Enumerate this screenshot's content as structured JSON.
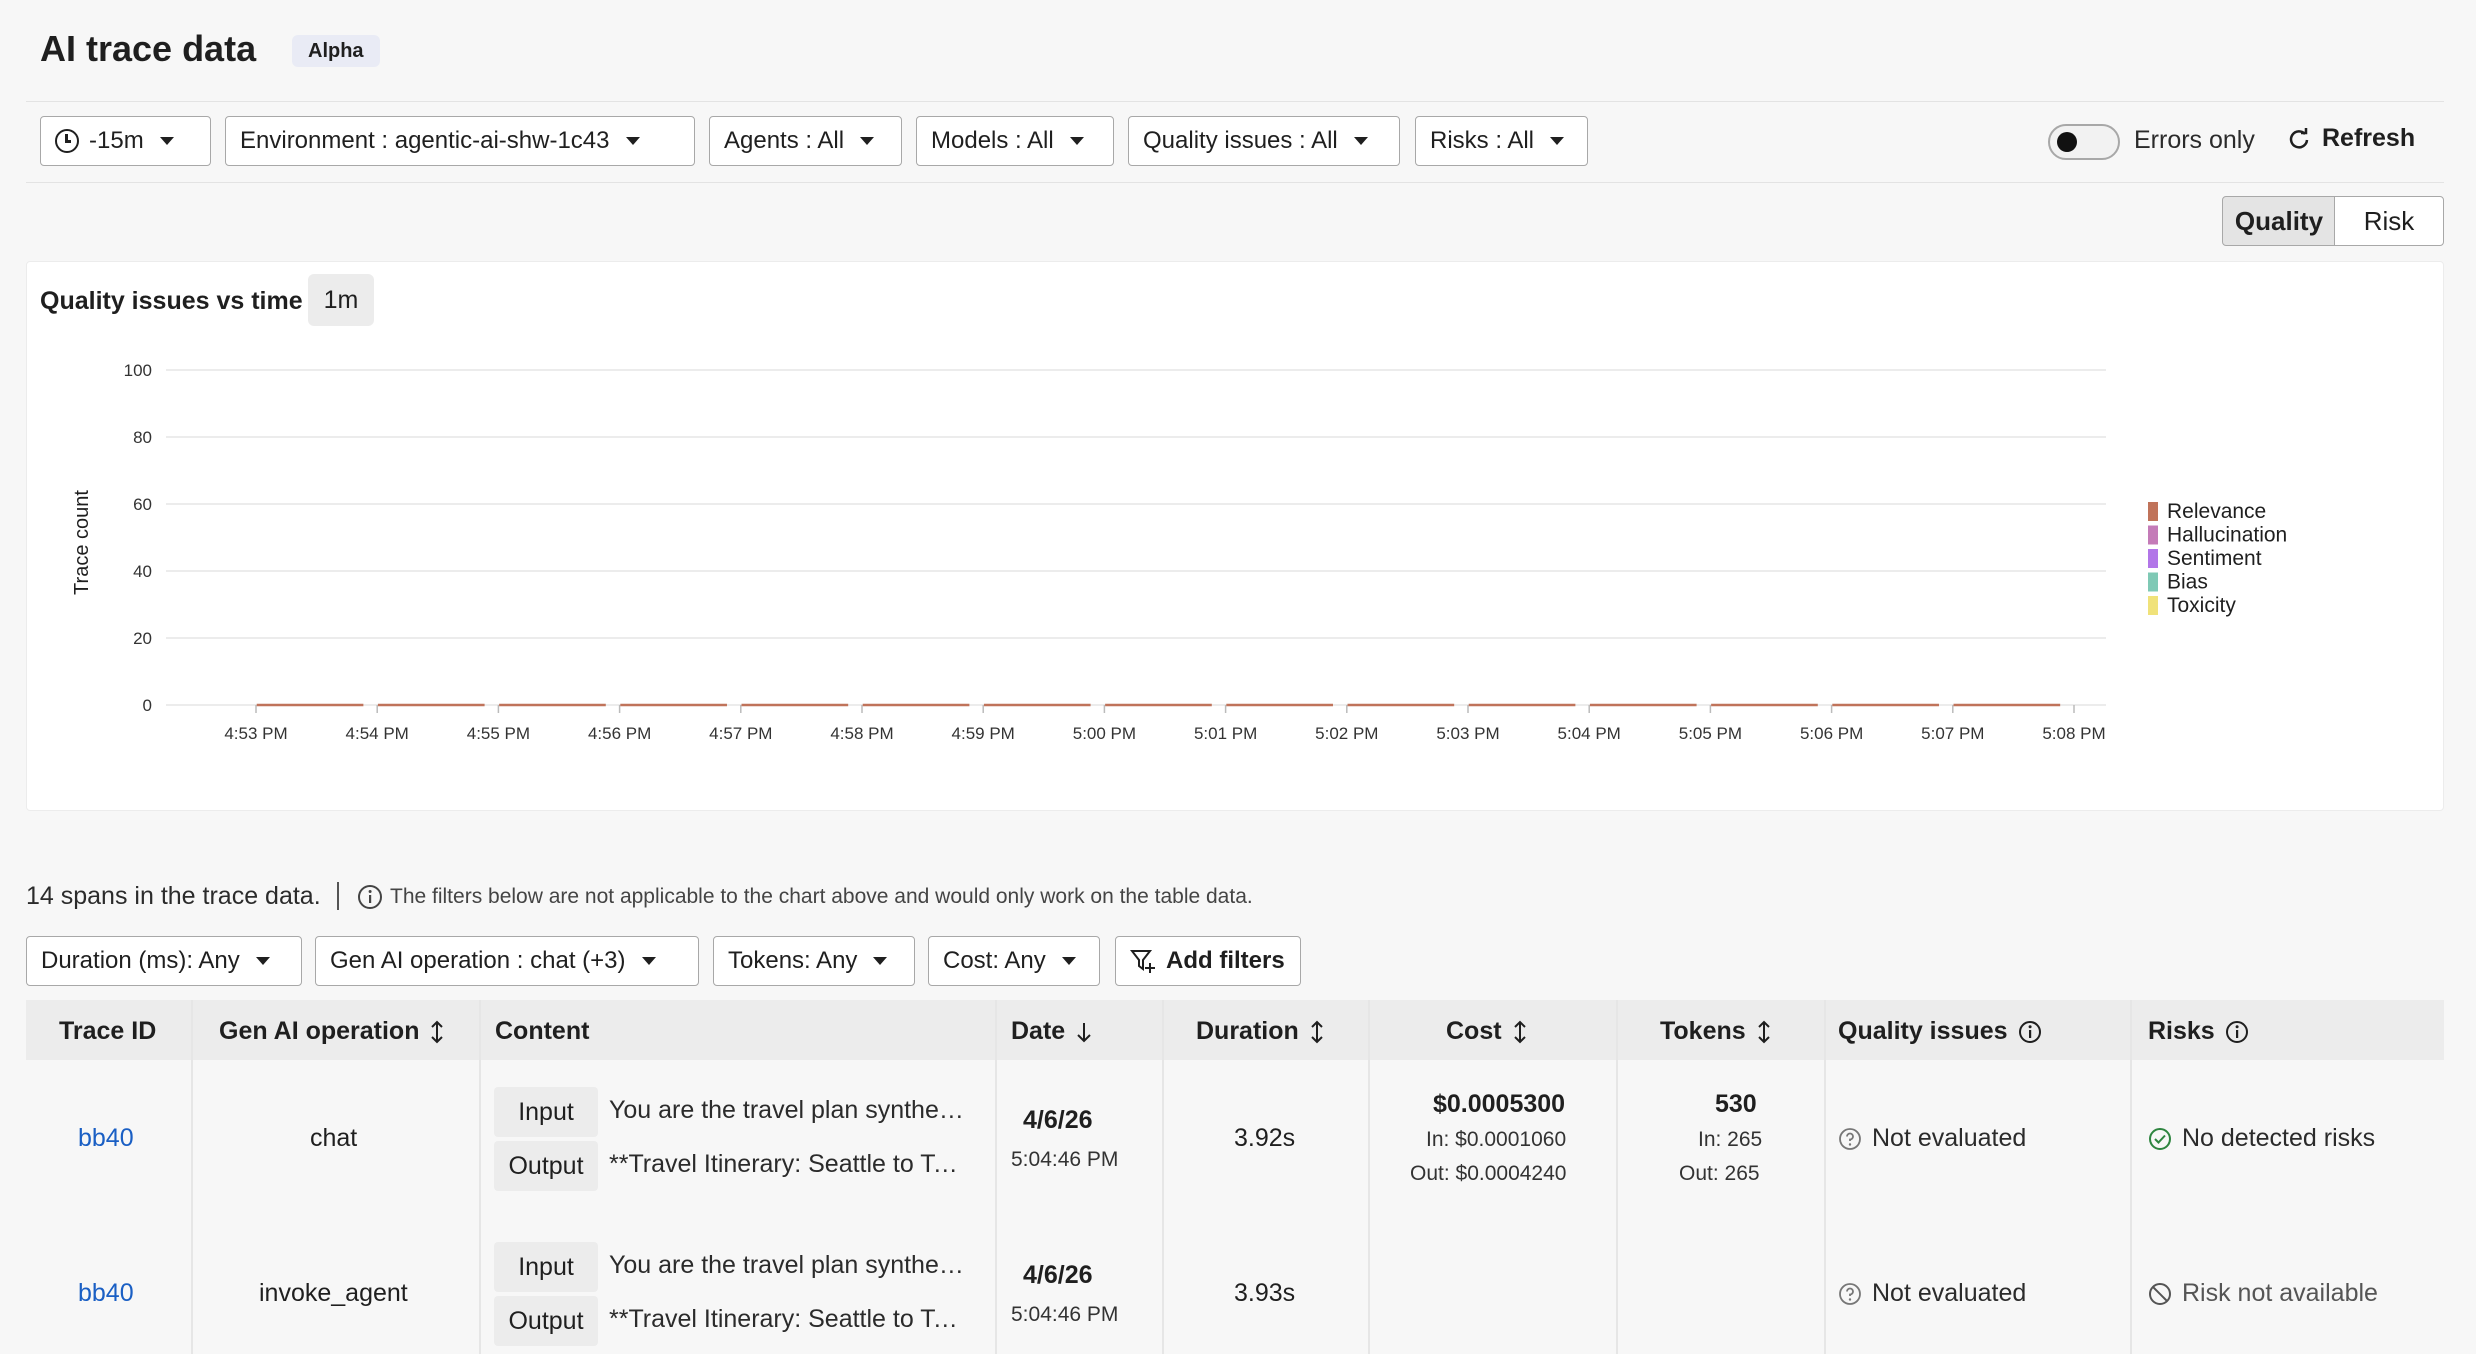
{
  "header": {
    "title": "AI trace data",
    "badge": "Alpha"
  },
  "filters": {
    "time": "-15m",
    "environment": "Environment : agentic-ai-shw-1c43",
    "agents": "Agents : All",
    "models": "Models : All",
    "quality": "Quality issues : All",
    "risks": "Risks : All",
    "errors_only_label": "Errors only",
    "errors_only": false,
    "refresh_label": "Refresh"
  },
  "view_toggle": {
    "quality": "Quality",
    "risk": "Risk",
    "active": "Quality"
  },
  "chart_header": {
    "title": "Quality issues vs time",
    "interval": "1m"
  },
  "chart_data": {
    "type": "bar",
    "title": "Quality issues vs time",
    "ylabel": "Trace count",
    "xlabel": "",
    "ylim": [
      0,
      100
    ],
    "yticks": [
      0,
      20,
      40,
      60,
      80,
      100
    ],
    "categories": [
      "4:53 PM",
      "4:54 PM",
      "4:55 PM",
      "4:56 PM",
      "4:57 PM",
      "4:58 PM",
      "4:59 PM",
      "5:00 PM",
      "5:01 PM",
      "5:02 PM",
      "5:03 PM",
      "5:04 PM",
      "5:05 PM",
      "5:06 PM",
      "5:07 PM",
      "5:08 PM"
    ],
    "series": [
      {
        "name": "Relevance",
        "color": "#c0735a",
        "values": [
          0,
          0,
          0,
          0,
          0,
          0,
          0,
          0,
          0,
          0,
          0,
          0,
          0,
          0,
          0,
          0
        ]
      },
      {
        "name": "Hallucination",
        "color": "#c47bb8",
        "values": [
          0,
          0,
          0,
          0,
          0,
          0,
          0,
          0,
          0,
          0,
          0,
          0,
          0,
          0,
          0,
          0
        ]
      },
      {
        "name": "Sentiment",
        "color": "#b276e8",
        "values": [
          0,
          0,
          0,
          0,
          0,
          0,
          0,
          0,
          0,
          0,
          0,
          0,
          0,
          0,
          0,
          0
        ]
      },
      {
        "name": "Bias",
        "color": "#7fc9b5",
        "values": [
          0,
          0,
          0,
          0,
          0,
          0,
          0,
          0,
          0,
          0,
          0,
          0,
          0,
          0,
          0,
          0
        ]
      },
      {
        "name": "Toxicity",
        "color": "#f0e27a",
        "values": [
          0,
          0,
          0,
          0,
          0,
          0,
          0,
          0,
          0,
          0,
          0,
          0,
          0,
          0,
          0,
          0
        ]
      }
    ],
    "grid": true,
    "legend": "right"
  },
  "table_info": {
    "span_count": "14 spans in the trace data.",
    "note": "The filters below are not applicable to the chart above and would only work on the table data."
  },
  "table_filters": {
    "duration": "Duration (ms): Any",
    "operation": "Gen AI operation : chat (+3)",
    "tokens": "Tokens: Any",
    "cost": "Cost: Any",
    "add": "Add filters"
  },
  "columns": {
    "trace_id": "Trace ID",
    "operation": "Gen AI operation",
    "content": "Content",
    "date": "Date",
    "duration": "Duration",
    "cost": "Cost",
    "tokens": "Tokens",
    "quality": "Quality issues",
    "risks": "Risks"
  },
  "rows": [
    {
      "trace_id": "bb40",
      "operation": "chat",
      "input_label": "Input",
      "input": "You are the travel plan synthesizer",
      "output_label": "Output",
      "output": "**Travel Itinerary: Seattle to Tokyo**",
      "date": "4/6/26",
      "time": "5:04:46 PM",
      "duration": "3.92s",
      "cost": "$0.0005300",
      "cost_in": "In: $0.0001060",
      "cost_out": "Out: $0.0004240",
      "tokens": "530",
      "tokens_in": "In: 265",
      "tokens_out": "Out: 265",
      "quality": "Not evaluated",
      "risk": "No detected risks"
    },
    {
      "trace_id": "bb40",
      "operation": "invoke_agent",
      "input_label": "Input",
      "input": "You are the travel plan synthesizer",
      "output_label": "Output",
      "output": "**Travel Itinerary: Seattle to Tokyo**",
      "date": "4/6/26",
      "time": "5:04:46 PM",
      "duration": "3.93s",
      "quality": "Not evaluated",
      "risk": "Risk not available"
    }
  ]
}
